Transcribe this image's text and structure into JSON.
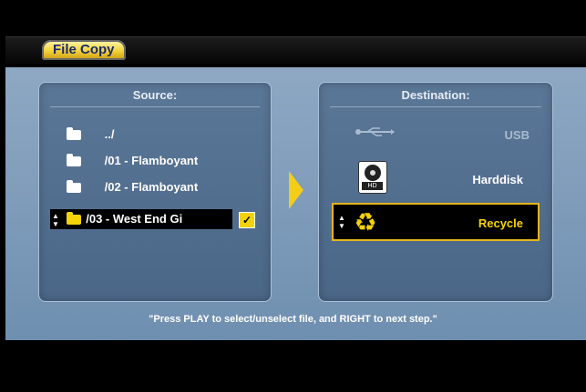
{
  "header": {
    "title": "File Copy"
  },
  "source": {
    "title": "Source:",
    "items": [
      {
        "label": "../"
      },
      {
        "label": "/01 - Flamboyant"
      },
      {
        "label": "/02 - Flamboyant"
      },
      {
        "label": "/03 - West End Gi",
        "selected": true,
        "checked": true
      }
    ]
  },
  "destination": {
    "title": "Destination:",
    "items": [
      {
        "label": "USB",
        "icon": "usb-icon"
      },
      {
        "label": "Harddisk",
        "icon": "harddisk-icon"
      },
      {
        "label": "Recycle",
        "icon": "recycle-icon",
        "selected": true
      }
    ]
  },
  "hint": {
    "text": "\"Press PLAY to select/unselect file, and RIGHT to next step.\""
  },
  "colors": {
    "accent": "#f4d20a",
    "panel": "#6f8fb0",
    "box": "#5b7797"
  }
}
